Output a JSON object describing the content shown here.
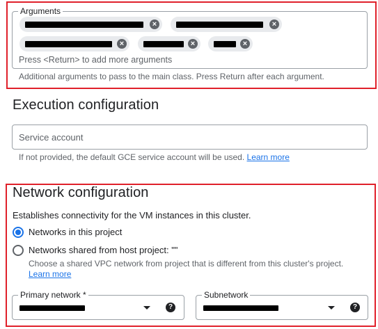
{
  "arguments": {
    "legend": "Arguments",
    "chips": [
      {
        "label_hidden": true
      },
      {
        "label_hidden": true
      },
      {
        "label_hidden": true
      },
      {
        "label_hidden": true
      },
      {
        "label_hidden": true
      }
    ],
    "placeholder": "Press <Return> to add more arguments",
    "hint": "Additional arguments to pass to the main class. Press Return after each argument."
  },
  "execution": {
    "title": "Execution configuration",
    "service_account_placeholder": "Service account",
    "hint": "If not provided, the default GCE service account will be used.",
    "learn_more": "Learn more"
  },
  "network": {
    "title": "Network configuration",
    "description": "Establishes connectivity for the VM instances in this cluster.",
    "option_project": "Networks in this project",
    "option_shared": "Networks shared from host project: \"\"",
    "shared_hint": "Choose a shared VPC network from project that is different from this cluster's project.",
    "learn_more": "Learn more",
    "selected_option": "Networks in this project",
    "primary_network_label": "Primary network *",
    "subnetwork_label": "Subnetwork"
  },
  "icons": {
    "chip_remove": "close-circle-icon",
    "dropdown": "arrow-drop-down-icon",
    "help": "help-icon"
  },
  "colors": {
    "highlight_border": "#e0202a",
    "accent": "#1a73e8",
    "chip_bg": "#e8eaed"
  }
}
